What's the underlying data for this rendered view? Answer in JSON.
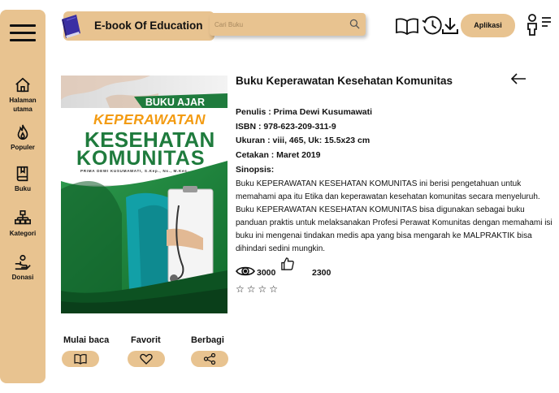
{
  "sidebar": {
    "items": [
      {
        "label_line1": "Halaman",
        "label_line2": "utama",
        "icon": "home-icon"
      },
      {
        "label": "Populer",
        "icon": "fire-icon"
      },
      {
        "label": "Buku",
        "icon": "book-icon"
      },
      {
        "label": "Kategori",
        "icon": "hierarchy-icon"
      },
      {
        "label": "Donasi",
        "icon": "donate-hand-icon"
      }
    ]
  },
  "header": {
    "title": "E-book Of Education",
    "search_placeholder": "Cari Buku",
    "app_button": "Aplikasi"
  },
  "book": {
    "title": "Buku Keperawatan Kesehatan Komunitas",
    "author": "Penulis : Prima Dewi Kusumawati",
    "isbn": "ISBN : 978-623-209-311-9",
    "size": "Ukuran : viii, 465, Uk: 15.5x23 cm",
    "print": "Cetakan : Maret 2019",
    "synopsis_label": "Sinopsis:",
    "synopsis": "Buku KEPERAWATAN KESEHATAN KOMUNITAS ini berisi pengetahuan untuk memahami apa itu Etika dan keperawatan kesehatan komunitas secara menyeluruh. Buku KEPERAWATAN KESEHATAN KOMUNITAS bisa digunakan sebagai buku panduan praktis untuk melaksanakan Profesi Perawat Komunitas dengan memahami isi buku ini mengenai tindakan medis apa yang bisa mengarah ke MALPRAKTIK bisa dihindari sedini mungkin.",
    "views": "3000",
    "likes": "2300",
    "rating_stars": "☆☆☆☆"
  },
  "cover": {
    "series": "BUKU AJAR",
    "line1": "KEPERAWATAN",
    "line2": "KESEHATAN",
    "line3": "KOMUNITAS",
    "authors": "PRIMA DEWI KUSUMAWATI, S.Kep., Ns., M.Kes."
  },
  "actions": [
    {
      "label": "Mulai baca",
      "icon": "open-book-icon"
    },
    {
      "label": "Favorit",
      "icon": "heart-icon"
    },
    {
      "label": "Berbagi",
      "icon": "share-icon"
    }
  ],
  "colors": {
    "accent": "#e8c390",
    "cover_green": "#1f7b3d",
    "cover_orange": "#f39b12"
  }
}
